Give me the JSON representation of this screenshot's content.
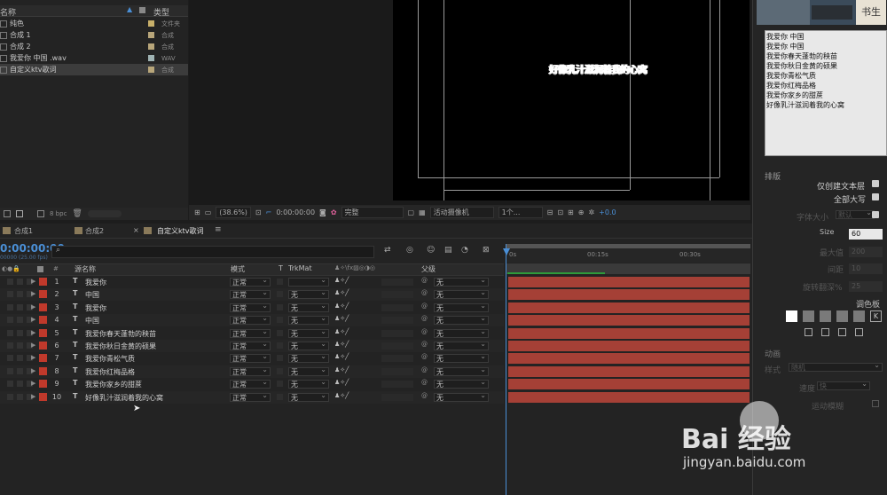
{
  "project": {
    "col_name": "名称",
    "col_type": "类型",
    "items": [
      {
        "name": "纯色",
        "type": "文件夹",
        "swatch": "#c8b06a"
      },
      {
        "name": "合成 1",
        "type": "合成",
        "swatch": "#b8a67a"
      },
      {
        "name": "合成 2",
        "type": "合成",
        "swatch": "#b8a67a"
      },
      {
        "name": "我爱你 中国 .wav",
        "type": "WAV",
        "swatch": "#9fb3b3"
      },
      {
        "name": "自定义ktv歌词",
        "type": "合成",
        "swatch": "#b8a67a"
      }
    ],
    "bpc": "8 bpc"
  },
  "viewer": {
    "lyric_text": "好像乳汁滋润着我的心窝",
    "zoom": "(38.6%)",
    "time": "0:00:00:00",
    "quality": "完整",
    "camera": "活动摄像机",
    "views": "1个...",
    "offset": "+0.0"
  },
  "right_panel": {
    "lines": [
      "我爱你 中国",
      "我爱你 中国",
      "我爱你春天蓬勃的秧苗",
      "我爱你秋日金黄的硕果",
      "我爱你青松气质",
      "我爱你红梅品格",
      "我爱你家乡的甜蔗",
      "好像乳汁滋润着我的心窝"
    ],
    "section_layout": "排版",
    "only_create_text_layer": "仅创建文本层",
    "all_caps": "全部大写",
    "font_size_label": "字体大小",
    "font_size_value": "默认",
    "size_label": "Size",
    "size_value": "60",
    "max_label": "最大值",
    "max_value": "200",
    "spacing_label": "间距",
    "spacing_value": "10",
    "rotate_label": "旋转翻深%",
    "rotate_value": "25",
    "palette_label": "调色板",
    "palette_swatches": [
      "#ffffff",
      "#7a7a7a",
      "#7a7a7a",
      "#7a7a7a",
      "#7a7a7a"
    ],
    "section_anim": "动画",
    "style_label": "样式",
    "style_value": "随机",
    "speed_label": "速度",
    "speed_value": "快",
    "motion_blur": "运动模糊"
  },
  "timeline": {
    "tabs": [
      "合成1",
      "合成2",
      "自定义ktv歌词"
    ],
    "timecode": "0:00:00:00",
    "fps": "00000 (25.00 fps)",
    "search_placeholder": "",
    "col_name": "源名称",
    "col_mode": "模式",
    "col_t": "T",
    "col_trkmat": "TrkMat",
    "col_parent": "父级",
    "ruler": [
      "0s",
      "00:15s",
      "00:30s"
    ],
    "layers": [
      {
        "num": "1",
        "name": "我爱你",
        "mode": "正常",
        "trkmat": "",
        "parent": "无"
      },
      {
        "num": "2",
        "name": "中国",
        "mode": "正常",
        "trkmat": "无",
        "parent": "无"
      },
      {
        "num": "3",
        "name": "我爱你",
        "mode": "正常",
        "trkmat": "无",
        "parent": "无"
      },
      {
        "num": "4",
        "name": "中国",
        "mode": "正常",
        "trkmat": "无",
        "parent": "无"
      },
      {
        "num": "5",
        "name": "我爱你春天蓬勃的秧苗",
        "mode": "正常",
        "trkmat": "无",
        "parent": "无"
      },
      {
        "num": "6",
        "name": "我爱你秋日金黄的硕果",
        "mode": "正常",
        "trkmat": "无",
        "parent": "无"
      },
      {
        "num": "7",
        "name": "我爱你青松气质",
        "mode": "正常",
        "trkmat": "无",
        "parent": "无"
      },
      {
        "num": "8",
        "name": "我爱你红梅品格",
        "mode": "正常",
        "trkmat": "无",
        "parent": "无"
      },
      {
        "num": "9",
        "name": "我爱你家乡的甜蔗",
        "mode": "正常",
        "trkmat": "无",
        "parent": "无"
      },
      {
        "num": "10",
        "name": "好像乳汁滋润着我的心窝",
        "mode": "正常",
        "trkmat": "无",
        "parent": "无"
      }
    ],
    "layer_color": "#c0392b",
    "bar_color": "#a54036"
  },
  "watermark": {
    "brand": "Bai 经验",
    "url": "jingyan.baidu.com"
  },
  "webcam": {
    "text": "书生"
  }
}
